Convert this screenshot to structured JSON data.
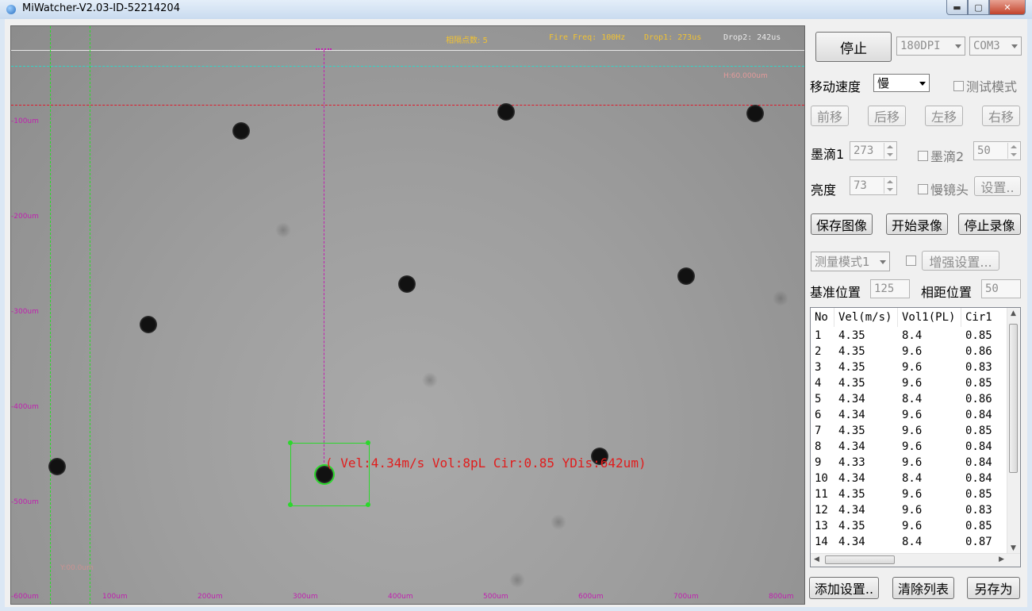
{
  "window": {
    "title": "MiWatcher-V2.03-ID-52214204",
    "minimize_glyph": "▬",
    "maximize_glyph": "▢",
    "close_glyph": "✕"
  },
  "view": {
    "hud": {
      "interval_points": "相隔点数: 5",
      "fire_freq": "Fire Freq: 100Hz",
      "drop1": "Drop1: 273us",
      "drop2": "Drop2: 242us"
    },
    "h_marker": "H:60.000um",
    "faint_label": "Y:00.0um",
    "y_ticks": [
      "-100um",
      "-200um",
      "-300um",
      "-400um",
      "-500um",
      "-600um"
    ],
    "x_ticks": [
      "100um",
      "200um",
      "300um",
      "400um",
      "500um",
      "600um",
      "700um",
      "800um"
    ],
    "measurement": "( Vel:4.34m/s Vol:8pL Cir:0.85 YDis:642um)",
    "colors": {
      "hud_yellow": "#f1c232",
      "tick_magenta": "#c11fb0",
      "guide_green": "#2bd82b",
      "guide_cyan": "#31d6c8",
      "guide_red": "#e0182a",
      "measure_red": "#e11c1c"
    }
  },
  "panel": {
    "stop_button": "停止",
    "dpi_select": "180DPI",
    "com_select": "COM3",
    "move_speed_label": "移动速度",
    "move_speed_value": "慢",
    "test_mode_label": "测试模式",
    "forward_button": "前移",
    "back_button": "后移",
    "left_button": "左移",
    "right_button": "右移",
    "drop1_label": "墨滴1",
    "drop1_value": "273",
    "drop2_label": "墨滴2",
    "drop2_value": "50",
    "brightness_label": "亮度",
    "brightness_value": "73",
    "slow_lens_label": "慢镜头",
    "settings_button": "设置..",
    "save_image_button": "保存图像",
    "start_record_button": "开始录像",
    "stop_record_button": "停止录像",
    "measure_mode_select": "测量模式1",
    "enhance_button": "增强设置...",
    "base_position_label": "基准位置",
    "base_position_value": "125",
    "spacing_position_label": "相距位置",
    "spacing_position_value": "50",
    "add_settings_button": "添加设置..",
    "clear_list_button": "清除列表",
    "save_as_button": "另存为",
    "table": {
      "headers": [
        "No",
        "Vel(m/s)",
        "Vol1(PL)",
        "Cir1"
      ],
      "rows": [
        [
          "1",
          "4.35",
          "8.4",
          "0.85"
        ],
        [
          "2",
          "4.35",
          "9.6",
          "0.86"
        ],
        [
          "3",
          "4.35",
          "9.6",
          "0.83"
        ],
        [
          "4",
          "4.35",
          "9.6",
          "0.85"
        ],
        [
          "5",
          "4.34",
          "8.4",
          "0.86"
        ],
        [
          "6",
          "4.34",
          "9.6",
          "0.84"
        ],
        [
          "7",
          "4.35",
          "9.6",
          "0.85"
        ],
        [
          "8",
          "4.34",
          "9.6",
          "0.84"
        ],
        [
          "9",
          "4.33",
          "9.6",
          "0.84"
        ],
        [
          "10",
          "4.34",
          "8.4",
          "0.84"
        ],
        [
          "11",
          "4.35",
          "9.6",
          "0.85"
        ],
        [
          "12",
          "4.34",
          "9.6",
          "0.83"
        ],
        [
          "13",
          "4.35",
          "9.6",
          "0.85"
        ],
        [
          "14",
          "4.34",
          "8.4",
          "0.87"
        ]
      ]
    }
  }
}
